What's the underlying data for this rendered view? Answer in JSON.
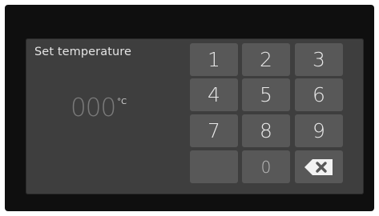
{
  "title": "Set temperature",
  "display": {
    "value": "000",
    "unit": "°C"
  },
  "keypad": {
    "k1": "1",
    "k2": "2",
    "k3": "3",
    "k4": "4",
    "k5": "5",
    "k6": "6",
    "k7": "7",
    "k8": "8",
    "k9": "9",
    "k0": "0",
    "backspace_icon": "backspace-icon"
  },
  "colors": {
    "bezel": "#0f0f0f",
    "panel": "#3e3e3e",
    "key": "#585858",
    "text": "#e8e8e8"
  }
}
